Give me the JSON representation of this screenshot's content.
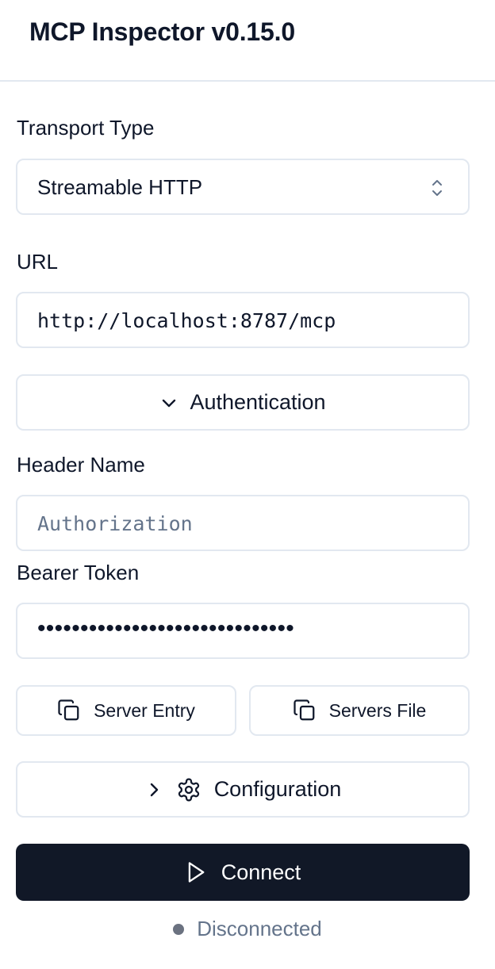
{
  "header": {
    "title": "MCP Inspector v0.15.0"
  },
  "transport": {
    "label": "Transport Type",
    "value": "Streamable HTTP"
  },
  "url": {
    "label": "URL",
    "value": "http://localhost:8787/mcp"
  },
  "auth": {
    "toggle_label": "Authentication",
    "header_name_label": "Header Name",
    "header_name_placeholder": "Authorization",
    "bearer_token_label": "Bearer Token",
    "bearer_token_masked": "••••••••••••••••••••••••••••••"
  },
  "copy_buttons": {
    "server_entry": "Server Entry",
    "servers_file": "Servers File"
  },
  "configuration": {
    "label": "Configuration"
  },
  "connect": {
    "label": "Connect",
    "color": "#111827"
  },
  "status": {
    "text": "Disconnected",
    "dot_color": "#6b7280"
  },
  "icons": {
    "select": "chevrons-up-down-icon",
    "auth": "chevron-down-icon",
    "copy": "copy-icon",
    "config_chevron": "chevron-right-icon",
    "config": "gear-icon",
    "connect": "play-icon"
  }
}
